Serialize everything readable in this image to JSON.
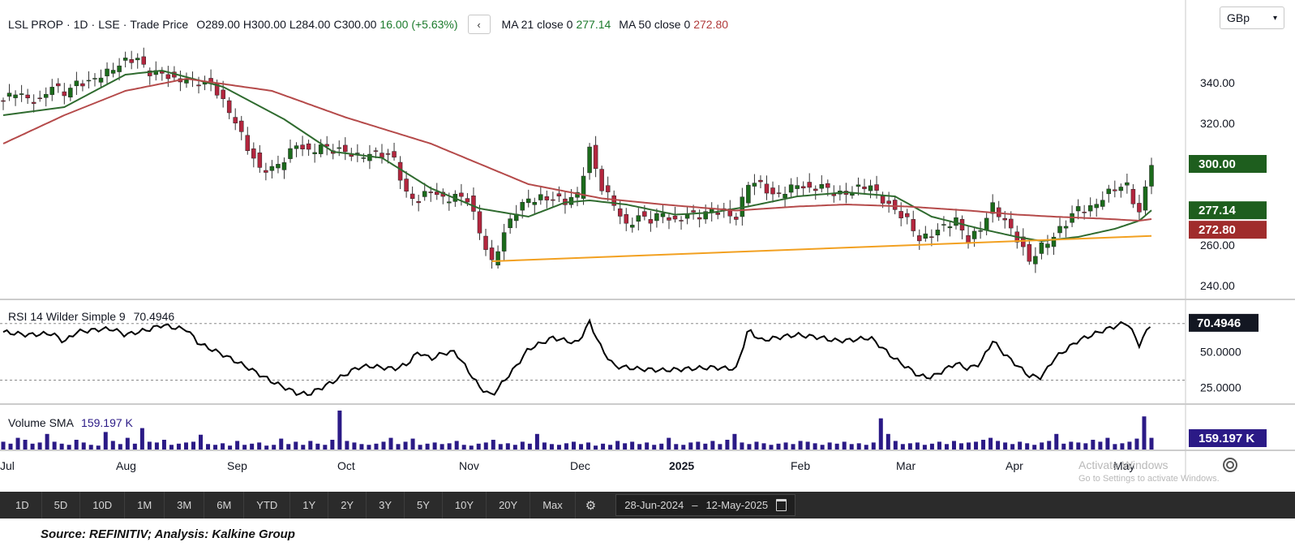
{
  "header": {
    "symbol": "LSL PROP",
    "interval": "1D",
    "exchange": "LSE",
    "price_type": "Trade Price",
    "open": "O289.00",
    "high": "H300.00",
    "low": "L284.00",
    "close": "C300.00",
    "change": "16.00 (+5.63%)",
    "nav_icon": "chevron-left-icon",
    "ma21_label": "MA 21 close 0",
    "ma21_value": "277.14",
    "ma50_label": "MA 50 close 0",
    "ma50_value": "272.80",
    "currency": "GBp"
  },
  "panes": {
    "rsi_label": "RSI 14 Wilder Simple 9",
    "rsi_value": "70.4946",
    "volume_label": "Volume SMA",
    "volume_value": "159.197 K"
  },
  "colors": {
    "up": "#1b6b1b",
    "down": "#b3263e",
    "ma21": "#2f6b2f",
    "ma50": "#b54a4a",
    "trendline": "#f2a020",
    "rsi": "#000000",
    "volume": "#2b1a86",
    "last_price_bg": "#1e5e1e",
    "ma50_tag_bg": "#a02c2c",
    "dark_tag_bg": "#131722",
    "volume_tag_bg": "#2b1a86"
  },
  "toolbar": {
    "ranges": [
      "1D",
      "5D",
      "10D",
      "1M",
      "3M",
      "6M",
      "YTD",
      "1Y",
      "2Y",
      "3Y",
      "5Y",
      "10Y",
      "20Y",
      "Max"
    ],
    "settings_icon": "gear-icon",
    "date_from": "28-Jun-2024",
    "date_sep": "–",
    "date_to": "12-May-2025",
    "calendar_icon": "calendar-icon"
  },
  "chart_settings_icon": "settings-icon",
  "source_text": "Source: REFINITIV; Analysis: Kalkine Group",
  "watermark": {
    "line1": "Activate Windows",
    "line2": "Go to Settings to activate Windows."
  },
  "chart_data": {
    "type": "candlestick",
    "x_tick_labels": [
      "Jul",
      "Aug",
      "Sep",
      "Oct",
      "Nov",
      "Dec",
      "2025",
      "Feb",
      "Mar",
      "Apr",
      "May"
    ],
    "price_axis": {
      "ticks": [
        "340.00",
        "320.00",
        "300.00",
        "260.00",
        "240.00"
      ],
      "tick_values": [
        340,
        320,
        300,
        260,
        240
      ],
      "range": [
        235,
        355
      ],
      "tags": [
        {
          "label": "300.00",
          "value": 300
        },
        {
          "label": "277.14",
          "value": 277.14
        },
        {
          "label": "272.80",
          "value": 272.8
        }
      ]
    },
    "candles_approx": [
      [
        0,
        330
      ],
      [
        2,
        336
      ],
      [
        4,
        333
      ],
      [
        6,
        330
      ],
      [
        8,
        338
      ],
      [
        10,
        336
      ],
      [
        12,
        340
      ],
      [
        14,
        339
      ],
      [
        16,
        344
      ],
      [
        18,
        348
      ],
      [
        20,
        350
      ],
      [
        22,
        351
      ],
      [
        24,
        346
      ],
      [
        26,
        345
      ],
      [
        28,
        340
      ],
      [
        30,
        342
      ],
      [
        32,
        341
      ],
      [
        34,
        339
      ],
      [
        36,
        330
      ],
      [
        38,
        322
      ],
      [
        40,
        308
      ],
      [
        42,
        296
      ],
      [
        44,
        298
      ],
      [
        46,
        303
      ],
      [
        48,
        309
      ],
      [
        50,
        305
      ],
      [
        52,
        310
      ],
      [
        54,
        307
      ],
      [
        56,
        305
      ],
      [
        58,
        304
      ],
      [
        60,
        306
      ],
      [
        62,
        304
      ],
      [
        64,
        302
      ],
      [
        66,
        286
      ],
      [
        68,
        282
      ],
      [
        70,
        286
      ],
      [
        72,
        283
      ],
      [
        74,
        285
      ],
      [
        76,
        282
      ],
      [
        78,
        266
      ],
      [
        80,
        252
      ],
      [
        82,
        266
      ],
      [
        84,
        276
      ],
      [
        86,
        283
      ],
      [
        88,
        284
      ],
      [
        90,
        282
      ],
      [
        92,
        281
      ],
      [
        94,
        286
      ],
      [
        96,
        307
      ],
      [
        98,
        287
      ],
      [
        100,
        281
      ],
      [
        102,
        270
      ],
      [
        104,
        273
      ],
      [
        106,
        272
      ],
      [
        108,
        277
      ],
      [
        110,
        271
      ],
      [
        112,
        274
      ],
      [
        114,
        275
      ],
      [
        116,
        278
      ],
      [
        118,
        275
      ],
      [
        120,
        273
      ],
      [
        122,
        292
      ],
      [
        124,
        290
      ],
      [
        126,
        283
      ],
      [
        128,
        287
      ],
      [
        130,
        291
      ],
      [
        132,
        286
      ],
      [
        134,
        289
      ],
      [
        136,
        287
      ],
      [
        138,
        285
      ],
      [
        140,
        287
      ],
      [
        142,
        290
      ],
      [
        144,
        283
      ],
      [
        146,
        276
      ],
      [
        148,
        272
      ],
      [
        150,
        264
      ],
      [
        152,
        265
      ],
      [
        154,
        268
      ],
      [
        156,
        273
      ],
      [
        158,
        263
      ],
      [
        160,
        267
      ],
      [
        162,
        279
      ],
      [
        164,
        273
      ],
      [
        166,
        263
      ],
      [
        168,
        251
      ],
      [
        170,
        260
      ],
      [
        172,
        265
      ],
      [
        174,
        270
      ],
      [
        176,
        278
      ],
      [
        178,
        279
      ],
      [
        180,
        283
      ],
      [
        182,
        287
      ],
      [
        184,
        290
      ],
      [
        186,
        276
      ],
      [
        188,
        300
      ]
    ],
    "series": [
      {
        "name": "MA 21 close 0",
        "points": [
          [
            0,
            324
          ],
          [
            10,
            328
          ],
          [
            20,
            344
          ],
          [
            26,
            346
          ],
          [
            36,
            338
          ],
          [
            46,
            322
          ],
          [
            54,
            306
          ],
          [
            62,
            303
          ],
          [
            70,
            288
          ],
          [
            78,
            278
          ],
          [
            86,
            274
          ],
          [
            92,
            281
          ],
          [
            96,
            282
          ],
          [
            102,
            280
          ],
          [
            110,
            275
          ],
          [
            116,
            276
          ],
          [
            122,
            279
          ],
          [
            130,
            284
          ],
          [
            138,
            286
          ],
          [
            146,
            284
          ],
          [
            152,
            274
          ],
          [
            160,
            268
          ],
          [
            166,
            264
          ],
          [
            170,
            262
          ],
          [
            176,
            264
          ],
          [
            182,
            268
          ],
          [
            186,
            272
          ],
          [
            188,
            277.14
          ]
        ]
      },
      {
        "name": "MA 50 close 0",
        "points": [
          [
            0,
            310
          ],
          [
            10,
            324
          ],
          [
            20,
            336
          ],
          [
            30,
            342
          ],
          [
            44,
            336
          ],
          [
            56,
            323
          ],
          [
            70,
            310
          ],
          [
            86,
            290
          ],
          [
            98,
            283
          ],
          [
            108,
            280
          ],
          [
            120,
            277
          ],
          [
            130,
            279
          ],
          [
            138,
            280
          ],
          [
            148,
            279
          ],
          [
            158,
            277
          ],
          [
            166,
            275
          ],
          [
            172,
            274
          ],
          [
            180,
            273
          ],
          [
            186,
            272
          ],
          [
            188,
            272.8
          ]
        ]
      },
      {
        "name": "Trendline",
        "points": [
          [
            80,
            252
          ],
          [
            188,
            264.5
          ]
        ]
      }
    ],
    "rsi": {
      "ticks": [
        "50.0000",
        "25.0000"
      ],
      "tick_values": [
        50,
        25
      ],
      "range": [
        15,
        80
      ],
      "overbought": 70,
      "oversold": 30,
      "last": "70.4946",
      "points": [
        [
          0,
          64
        ],
        [
          4,
          62
        ],
        [
          8,
          63
        ],
        [
          10,
          57
        ],
        [
          12,
          64
        ],
        [
          16,
          66
        ],
        [
          18,
          66
        ],
        [
          20,
          62
        ],
        [
          24,
          66
        ],
        [
          26,
          69
        ],
        [
          28,
          67
        ],
        [
          30,
          66
        ],
        [
          32,
          56
        ],
        [
          36,
          48
        ],
        [
          40,
          39
        ],
        [
          44,
          29
        ],
        [
          48,
          21
        ],
        [
          50,
          20
        ],
        [
          54,
          29
        ],
        [
          58,
          39
        ],
        [
          60,
          40
        ],
        [
          64,
          38
        ],
        [
          66,
          41
        ],
        [
          68,
          50
        ],
        [
          70,
          45
        ],
        [
          72,
          49
        ],
        [
          74,
          50
        ],
        [
          78,
          25
        ],
        [
          80,
          19
        ],
        [
          84,
          40
        ],
        [
          86,
          52
        ],
        [
          90,
          60
        ],
        [
          94,
          56
        ],
        [
          96,
          71
        ],
        [
          98,
          52
        ],
        [
          100,
          40
        ],
        [
          104,
          38
        ],
        [
          108,
          37
        ],
        [
          112,
          38
        ],
        [
          116,
          39
        ],
        [
          120,
          38
        ],
        [
          122,
          66
        ],
        [
          124,
          58
        ],
        [
          128,
          61
        ],
        [
          130,
          62
        ],
        [
          134,
          60
        ],
        [
          136,
          58
        ],
        [
          138,
          58
        ],
        [
          142,
          60
        ],
        [
          146,
          45
        ],
        [
          150,
          33
        ],
        [
          152,
          32
        ],
        [
          156,
          42
        ],
        [
          158,
          38
        ],
        [
          160,
          42
        ],
        [
          162,
          58
        ],
        [
          164,
          48
        ],
        [
          168,
          33
        ],
        [
          170,
          32
        ],
        [
          172,
          45
        ],
        [
          176,
          58
        ],
        [
          180,
          65
        ],
        [
          184,
          71
        ],
        [
          186,
          55
        ],
        [
          188,
          70.49
        ]
      ]
    },
    "volume": {
      "sma_last": "159.197 K",
      "bars_rel": [
        20,
        15,
        30,
        25,
        15,
        18,
        40,
        20,
        15,
        12,
        25,
        18,
        12,
        10,
        45,
        22,
        14,
        30,
        15,
        55,
        20,
        18,
        25,
        12,
        15,
        18,
        20,
        38,
        14,
        12,
        16,
        10,
        22,
        12,
        15,
        18,
        10,
        12,
        28,
        14,
        20,
        12,
        22,
        15,
        12,
        25,
        100,
        22,
        18,
        14,
        12,
        15,
        20,
        30,
        14,
        20,
        28,
        12,
        15,
        18,
        14,
        16,
        22,
        12,
        10,
        15,
        18,
        25,
        14,
        16,
        12,
        20,
        15,
        40,
        18,
        14,
        12,
        16,
        20,
        14,
        18,
        10,
        15,
        12,
        22,
        16,
        20,
        14,
        18,
        12,
        15,
        30,
        14,
        12,
        18,
        20,
        15,
        22,
        14,
        25,
        40,
        18,
        14,
        20,
        16,
        12,
        15,
        18,
        14,
        22,
        20,
        16,
        12,
        18,
        15,
        20,
        14,
        16,
        12,
        18,
        80,
        40,
        22,
        14,
        16,
        18,
        12,
        15,
        20,
        14,
        22,
        16,
        18,
        20,
        25,
        30,
        22,
        18,
        14,
        20,
        16,
        12,
        18,
        22,
        40,
        15,
        20,
        18,
        16,
        25,
        20,
        30,
        14,
        16,
        20,
        28,
        85,
        30
      ]
    },
    "grid": false
  }
}
